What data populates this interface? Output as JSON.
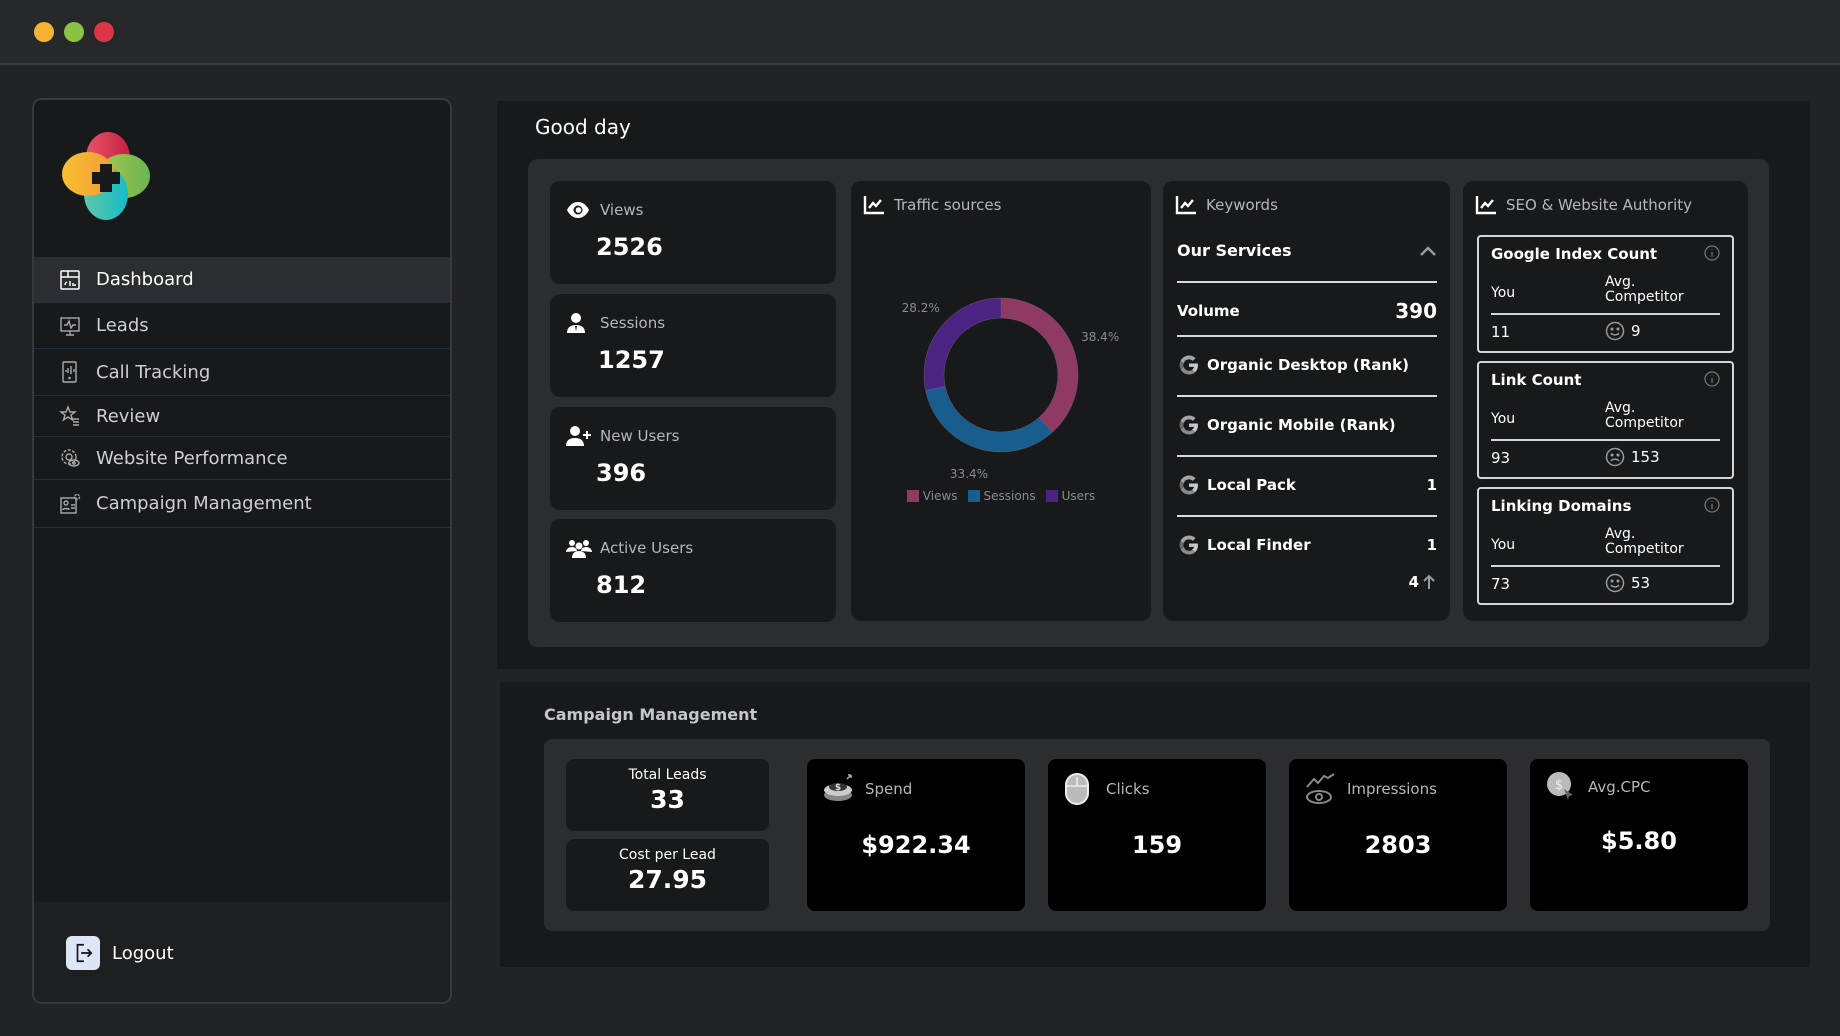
{
  "window": {
    "controls": [
      "minimize",
      "maximize",
      "close"
    ]
  },
  "sidebar": {
    "items": [
      {
        "label": "Dashboard",
        "icon": "dashboard-icon",
        "active": true
      },
      {
        "label": "Leads",
        "icon": "leads-monitor-icon",
        "active": false
      },
      {
        "label": "Call Tracking",
        "icon": "call-tracking-icon",
        "active": false
      },
      {
        "label": "Review",
        "icon": "star-list-icon",
        "active": false
      },
      {
        "label": "Website Performance",
        "icon": "gear-eye-icon",
        "active": false
      },
      {
        "label": "Campaign Management",
        "icon": "campaign-settings-icon",
        "active": false
      }
    ],
    "logout_label": "Logout"
  },
  "main": {
    "greeting": "Good day",
    "stats": [
      {
        "label": "Views",
        "value": "2526",
        "icon": "eye-icon"
      },
      {
        "label": "Sessions",
        "value": "1257",
        "icon": "user-icon"
      },
      {
        "label": "New Users",
        "value": "396",
        "icon": "user-plus-icon"
      },
      {
        "label": "Active Users",
        "value": "812",
        "icon": "users-icon"
      }
    ],
    "traffic": {
      "title": "Traffic sources"
    },
    "keywords": {
      "title": "Keywords",
      "section": "Our Services",
      "volume_label": "Volume",
      "volume_value": "390",
      "rows": [
        {
          "label": "Organic Desktop (Rank)",
          "value": ""
        },
        {
          "label": "Organic Mobile (Rank)",
          "value": ""
        },
        {
          "label": "Local Pack",
          "value": "1"
        },
        {
          "label": "Local Finder",
          "value": "1"
        }
      ],
      "footer_value": "4"
    },
    "seo": {
      "title": "SEO & Website Authority",
      "you_label": "You",
      "avg_label": "Avg. Competitor",
      "boxes": [
        {
          "title": "Google Index Count",
          "you": "11",
          "avg": "9",
          "mood": "happy"
        },
        {
          "title": "Link Count",
          "you": "93",
          "avg": "153",
          "mood": "sad"
        },
        {
          "title": "Linking Domains",
          "you": "73",
          "avg": "53",
          "mood": "happy"
        }
      ]
    }
  },
  "campaign": {
    "title": "Campaign Management",
    "total_leads_label": "Total Leads",
    "total_leads_value": "33",
    "cpl_label": "Cost per Lead",
    "cpl_value": "27.95",
    "metrics": [
      {
        "label": "Spend",
        "value": "$922.34",
        "icon": "money-coin-icon"
      },
      {
        "label": "Clicks",
        "value": "159",
        "icon": "mouse-icon"
      },
      {
        "label": "Impressions",
        "value": "2803",
        "icon": "eye-trend-icon"
      },
      {
        "label": "Avg.CPC",
        "value": "$5.80",
        "icon": "coin-cursor-icon"
      }
    ]
  },
  "chart_data": {
    "type": "pie",
    "title": "Traffic sources",
    "donut": true,
    "categories": [
      "Views",
      "Sessions",
      "Users"
    ],
    "values": [
      38.4,
      33.4,
      28.2
    ],
    "labels": [
      "38.4%",
      "33.4%",
      "28.2%"
    ],
    "colors": [
      "#8e3a63",
      "#175e8e",
      "#4b2383"
    ],
    "legend": "bottom"
  }
}
